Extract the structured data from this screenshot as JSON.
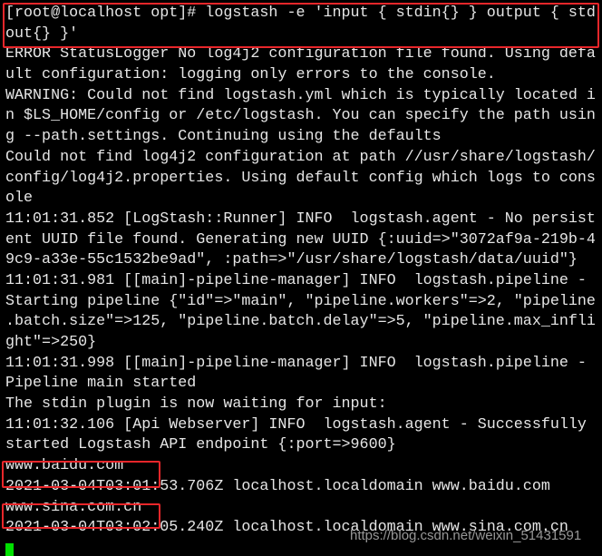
{
  "terminal": {
    "lines": [
      "[root@localhost opt]# logstash -e 'input { stdin{} } output { std",
      "out{} }'",
      "ERROR StatusLogger No log4j2 configuration file found. Using defa",
      "ult configuration: logging only errors to the console.",
      "WARNING: Could not find logstash.yml which is typically located i",
      "n $LS_HOME/config or /etc/logstash. You can specify the path usin",
      "g --path.settings. Continuing using the defaults",
      "Could not find log4j2 configuration at path //usr/share/logstash/",
      "config/log4j2.properties. Using default config which logs to cons",
      "ole",
      "11:01:31.852 [LogStash::Runner] INFO  logstash.agent - No persist",
      "ent UUID file found. Generating new UUID {:uuid=>\"3072af9a-219b-4",
      "9c9-a33e-55c1532be9ad\", :path=>\"/usr/share/logstash/data/uuid\"}",
      "11:01:31.981 [[main]-pipeline-manager] INFO  logstash.pipeline -",
      "Starting pipeline {\"id\"=>\"main\", \"pipeline.workers\"=>2, \"pipeline",
      ".batch.size\"=>125, \"pipeline.batch.delay\"=>5, \"pipeline.max_infli",
      "ght\"=>250}",
      "11:01:31.998 [[main]-pipeline-manager] INFO  logstash.pipeline -",
      "Pipeline main started",
      "The stdin plugin is now waiting for input:",
      "11:01:32.106 [Api Webserver] INFO  logstash.agent - Successfully",
      "started Logstash API endpoint {:port=>9600}",
      "www.baidu.com",
      "2021-03-04T03:01:53.706Z localhost.localdomain www.baidu.com",
      "www.sina.com.cn",
      "2021-03-04T03:02:05.240Z localhost.localdomain www.sina.com.cn"
    ]
  },
  "watermark": "https://blog.csdn.net/weixin_51431591",
  "colors": {
    "background": "#000000",
    "text": "#e6e6e6",
    "highlight": "#e8262a",
    "cursor": "#00e000"
  }
}
